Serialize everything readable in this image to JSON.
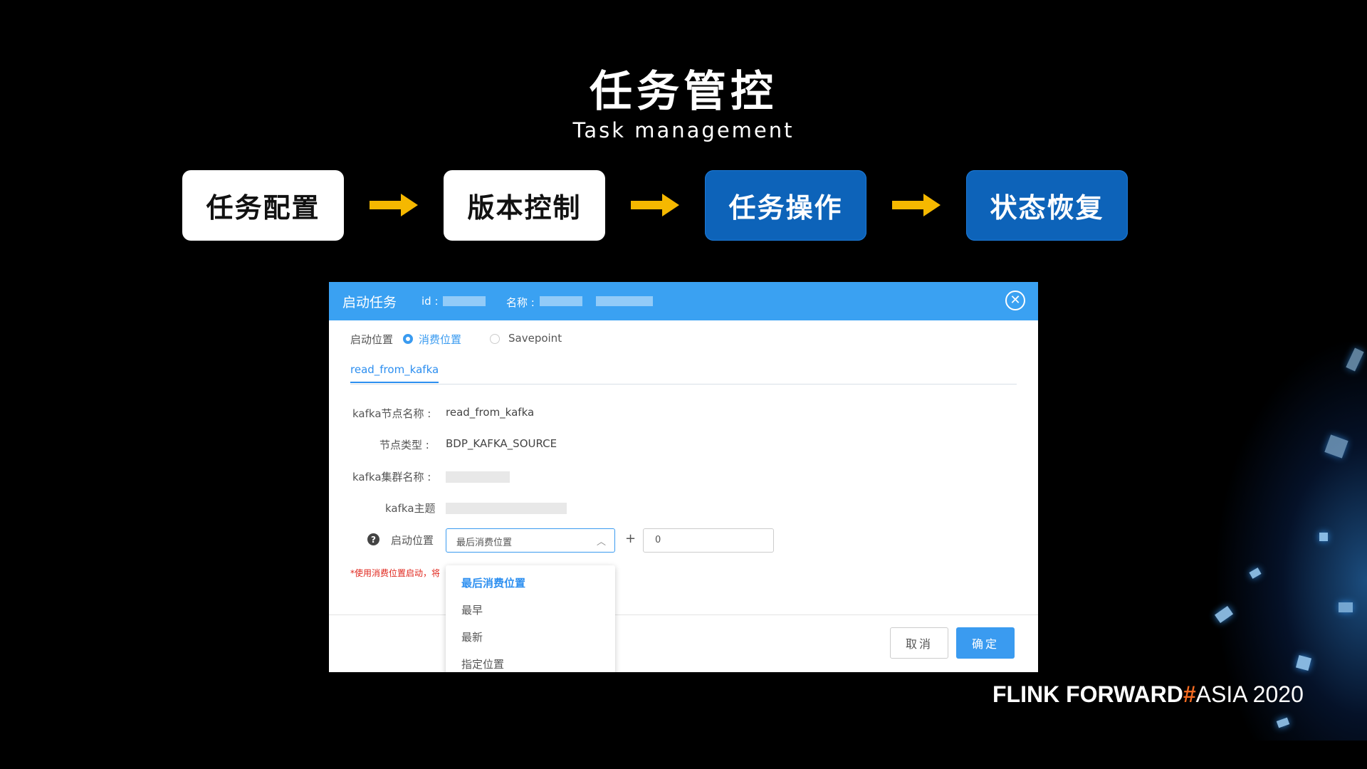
{
  "slide": {
    "title": "任务管控",
    "subtitle": "Task management"
  },
  "steps": [
    {
      "label": "任务配置",
      "style": "light"
    },
    {
      "label": "版本控制",
      "style": "light"
    },
    {
      "label": "任务操作",
      "style": "dark"
    },
    {
      "label": "状态恢复",
      "style": "dark"
    }
  ],
  "colors": {
    "arrow": "#f5b800",
    "step_dark": "#0d63b9",
    "dialog_header": "#3aa1f2",
    "primary": "#3a9bf0",
    "warning": "#e0261c",
    "brand_hash": "#f26a21"
  },
  "dialog": {
    "title": "启动任务",
    "id_label": "id :",
    "name_label": "名称 :",
    "close_icon": "close-circle-icon",
    "start_label": "启动位置",
    "radio_options": [
      {
        "label": "消费位置",
        "selected": true
      },
      {
        "label": "Savepoint",
        "selected": false
      }
    ],
    "tab": "read_from_kafka",
    "fields": {
      "node_name_label": "kafka节点名称 :",
      "node_name_value": "read_from_kafka",
      "node_type_label": "节点类型 :",
      "node_type_value": "BDP_KAFKA_SOURCE",
      "cluster_label": "kafka集群名称 :",
      "topic_label": "kafka主题",
      "start_pos_label": "启动位置"
    },
    "select_value": "最后消费位置",
    "plus": "+",
    "offset_value": "0",
    "warning": "*使用消费位置启动，将",
    "dropdown_options": [
      "最后消费位置",
      "最早",
      "最新",
      "指定位置"
    ],
    "cancel": "取消",
    "ok": "确定"
  },
  "brand": {
    "part1": "FLINK FORWARD",
    "hash": "#",
    "part2": "ASIA 2020"
  }
}
